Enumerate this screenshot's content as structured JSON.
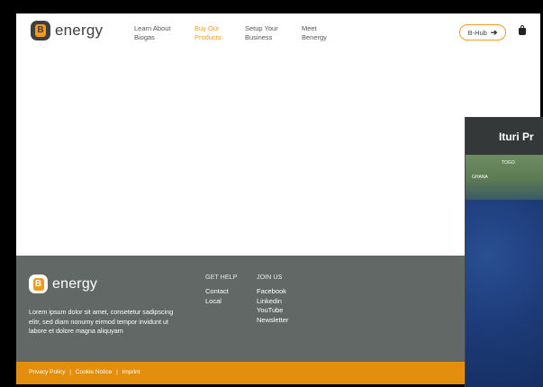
{
  "brand": {
    "logo_letter": "B",
    "name": "energy"
  },
  "nav": [
    {
      "line1": "Learn About",
      "line2": "Biogas",
      "active": false
    },
    {
      "line1": "Buy Our",
      "line2": "Products",
      "active": true
    },
    {
      "line1": "Setup Your",
      "line2": "Business",
      "active": false
    },
    {
      "line1": "Meet",
      "line2": "Benergy",
      "active": false
    }
  ],
  "header_actions": {
    "bhub_label": "B-Hub",
    "bhub_icon": "login-arrow-icon",
    "cart_icon": "shopping-bag-icon"
  },
  "footer": {
    "description": "Lorem ipsum dolor sit amet, consetetur sadipscing elitr, sed diam nonumy eirmod tempor invidunt ut labore et dolore magna aliquyam",
    "get_help": {
      "heading": "GET HELP",
      "links": [
        "Contact",
        "Local"
      ]
    },
    "join_us": {
      "heading": "JOIN US",
      "links": [
        "Facebook",
        "Linkedin",
        "YouTube",
        "Newsletter"
      ]
    },
    "legal": {
      "privacy": "Privacy Policy",
      "cookie": "Cookie Notice",
      "imprint": "Imprint",
      "separator": "|"
    }
  },
  "map_overlay": {
    "title": "Ituri Pr",
    "labels": [
      "TOGO",
      "GHANA"
    ]
  },
  "colors": {
    "accent": "#f39a1a",
    "footer_bg": "#626866",
    "bottom_bar": "#e38f0d",
    "text_dark": "#3f3f3f"
  }
}
